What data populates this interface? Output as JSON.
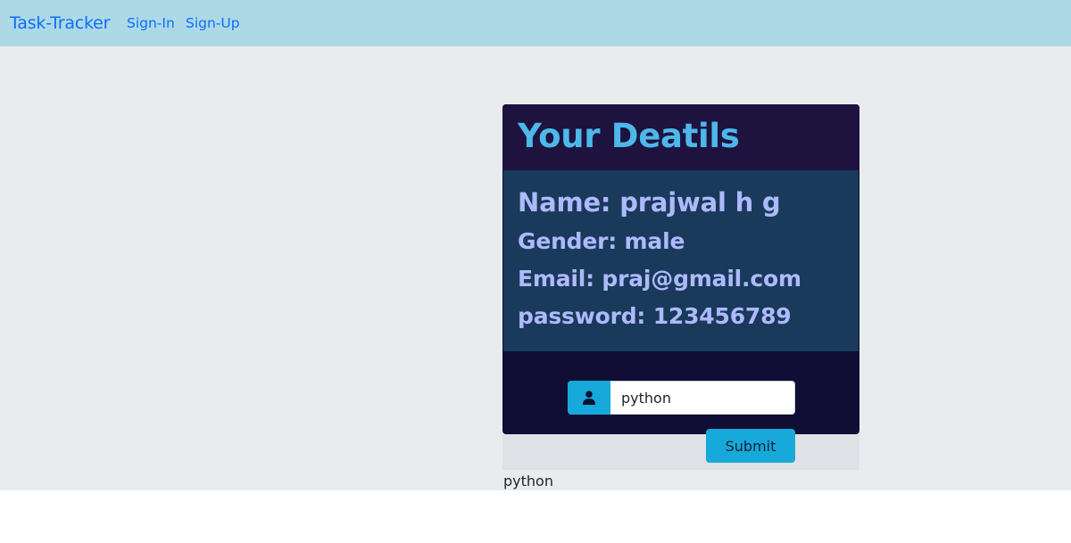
{
  "navbar": {
    "brand": "Task-Tracker",
    "links": [
      "Sign-In",
      "Sign-Up"
    ]
  },
  "card": {
    "title": "Your Deatils",
    "details": {
      "name": "Name: prajwal h g",
      "gender": "Gender: male",
      "email": "Email: praj@gmail.com",
      "password": "password: 123456789"
    },
    "input": {
      "value": "python",
      "icon": "user-icon"
    },
    "submit_label": "Submit"
  },
  "echo": "python",
  "colors": {
    "navbar_bg": "#add8e6",
    "link": "#0d6efd",
    "card_bg": "#100e34",
    "header_bg": "#1e133f",
    "body_bg": "#193a5a",
    "title": "#4db8ea",
    "detail_text": "#aeb9ff",
    "accent": "#17a9d9"
  }
}
